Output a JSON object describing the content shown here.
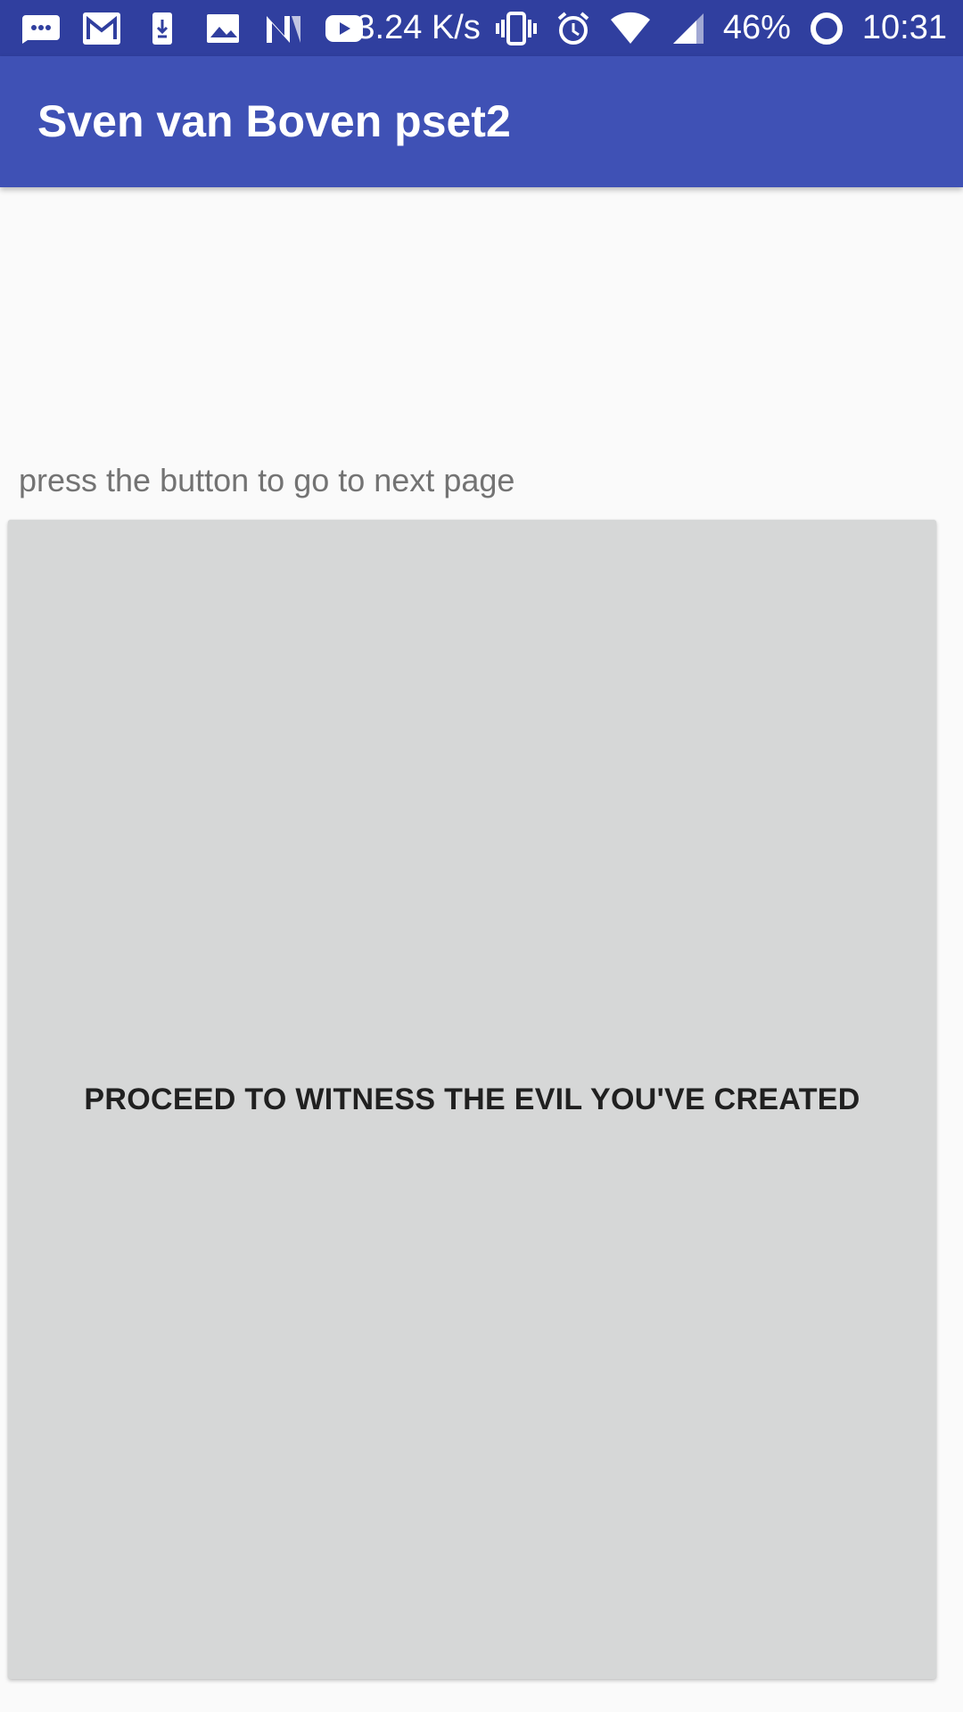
{
  "status_bar": {
    "left_icons": [
      "chat-bubble-icon",
      "gmail-icon",
      "download-icon",
      "image-icon",
      "nova-n-icon",
      "youtube-icon"
    ],
    "network_speed": "3.24 K/s",
    "right_icons": [
      "vibrate-icon",
      "alarm-icon",
      "wifi-icon",
      "signal-icon",
      "data-saver-icon"
    ],
    "battery": "46%",
    "time": "10:31"
  },
  "toolbar": {
    "title": "Sven van Boven pset2"
  },
  "main": {
    "prompt": "press the button to go to next page",
    "button_label": "PROCEED TO WITNESS THE EVIL YOU'VE CREATED"
  },
  "colors": {
    "status_bar": "#303f9f",
    "toolbar": "#3f51b5",
    "background": "#fafafa",
    "button": "#d6d7d7"
  }
}
